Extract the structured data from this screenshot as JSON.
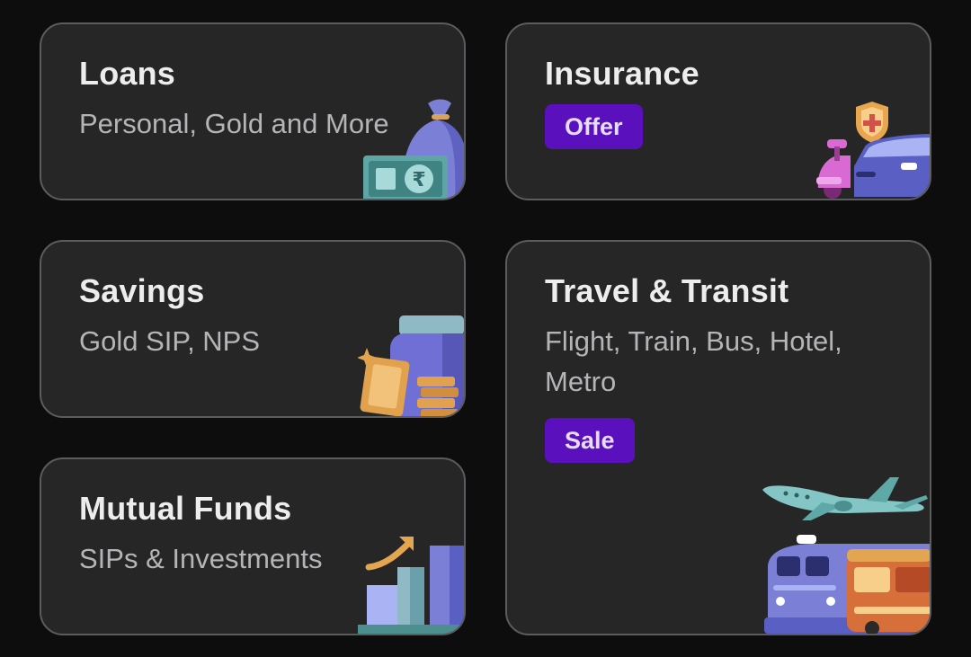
{
  "cards": {
    "loans": {
      "title": "Loans",
      "subtitle": "Personal, Gold and More",
      "icon": "money-bag-icon"
    },
    "insurance": {
      "title": "Insurance",
      "badge": "Offer",
      "icon": "vehicle-insurance-icon"
    },
    "savings": {
      "title": "Savings",
      "subtitle": "Gold SIP, NPS",
      "icon": "gold-jar-icon"
    },
    "travel": {
      "title": "Travel & Transit",
      "subtitle_line1": "Flight, Train, Bus, Hotel,",
      "subtitle_line2": "Metro",
      "badge": "Sale",
      "icon": "travel-icon"
    },
    "mutual_funds": {
      "title": "Mutual Funds",
      "subtitle": "SIPs & Investments",
      "icon": "growth-chart-icon"
    }
  },
  "colors": {
    "background": "#0d0d0e",
    "card": "#262627",
    "card_border": "#5c5c5e",
    "badge": "#5a10bd"
  }
}
